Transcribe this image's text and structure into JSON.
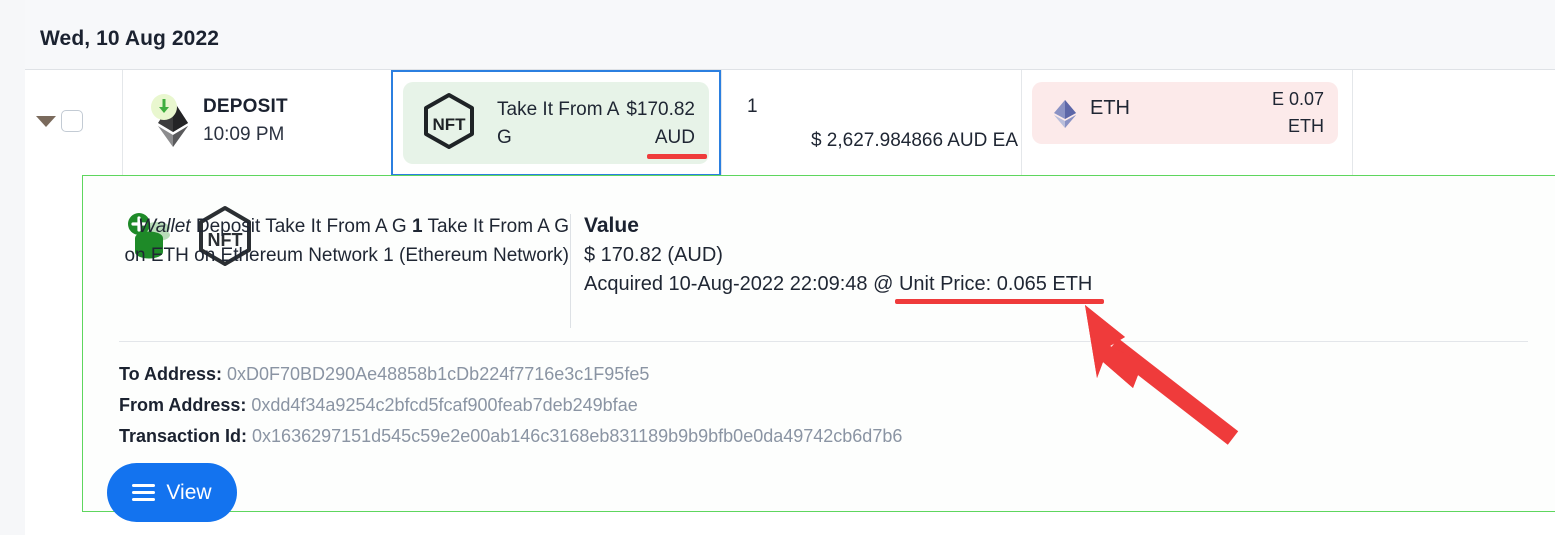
{
  "header": {
    "date_label": "Wed, 10 Aug 2022"
  },
  "transaction_row": {
    "expand_icon": "chevron-down-icon",
    "checkbox_checked": false,
    "asset_icon": "ethereum-logo-icon",
    "direction_icon": "arrow-down-icon",
    "type_label": "DEPOSIT",
    "time_label": "10:09 PM",
    "nft": {
      "icon": "nft-hexagon-icon",
      "name": "Take It From A G",
      "amount": "$170.82",
      "currency": "AUD"
    },
    "quantity": "1",
    "rate": "$ 2,627.984866 AUD EA",
    "price": {
      "icon": "ethereum-diamond-icon",
      "symbol": "ETH",
      "amount": "E 0.07",
      "unit": "ETH"
    }
  },
  "detail_panel": {
    "coins_icon": "coins-plus-icon",
    "nft_icon": "nft-hexagon-icon",
    "description_prefix": "Wallet",
    "description_middle": " Deposit Take It From A G ",
    "description_qty": "1",
    "description_suffix": "Take It From A G on ETH on Ethereum Network 1 (Ethereum Network)",
    "value_title": "Value",
    "value_amount": "$ 170.82 (AUD)",
    "acquired_prefix": "Acquired 10-Aug-2022 22:09:48  @ ",
    "unit_price": "Unit Price: 0.065 ETH",
    "fields": [
      {
        "label": "To Address:",
        "value": "0xD0F70BD290Ae48858b1cDb224f7716e3c1F95fe5"
      },
      {
        "label": "From Address:",
        "value": "0xdd4f34a9254c2bfcd5fcaf900feab7deb249bfae"
      },
      {
        "label": "Transaction Id:",
        "value": "0x1636297151d545c59e2e00ab146c3168eb831189b9b9bfb0e0da49742cb6d7b6"
      }
    ],
    "view_button_label": "View",
    "view_button_icon": "hamburger-menu-icon"
  },
  "annotations": {
    "arrow_icon": "red-arrow-annotation",
    "arrow_color": "#ef3b3b",
    "underline_color": "#ef3b3b",
    "highlight_border_color": "#2b7fe0",
    "panel_border_color": "#5ed65e"
  }
}
